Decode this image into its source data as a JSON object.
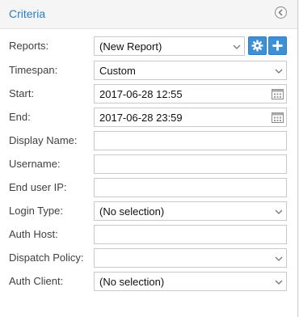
{
  "header": {
    "title": "Criteria"
  },
  "fields": {
    "reports": {
      "label": "Reports:",
      "value": "(New Report)"
    },
    "timespan": {
      "label": "Timespan:",
      "value": "Custom"
    },
    "start": {
      "label": "Start:",
      "value": "2017-06-28 12:55"
    },
    "end": {
      "label": "End:",
      "value": "2017-06-28 23:59"
    },
    "display_name": {
      "label": "Display Name:",
      "value": ""
    },
    "username": {
      "label": "Username:",
      "value": ""
    },
    "end_user_ip": {
      "label": "End user IP:",
      "value": ""
    },
    "login_type": {
      "label": "Login Type:",
      "value": "(No selection)"
    },
    "auth_host": {
      "label": "Auth Host:",
      "value": ""
    },
    "dispatch_policy": {
      "label": "Dispatch Policy:",
      "value": ""
    },
    "auth_client": {
      "label": "Auth Client:",
      "value": "(No selection)"
    }
  },
  "icons": {
    "collapse": "chevron-left-circle-icon",
    "settings": "gear-icon",
    "add": "plus-icon",
    "calendar": "calendar-icon",
    "dropdown": "chevron-down-icon"
  },
  "colors": {
    "accent": "#3d8fd6",
    "title": "#2b7fc0"
  }
}
